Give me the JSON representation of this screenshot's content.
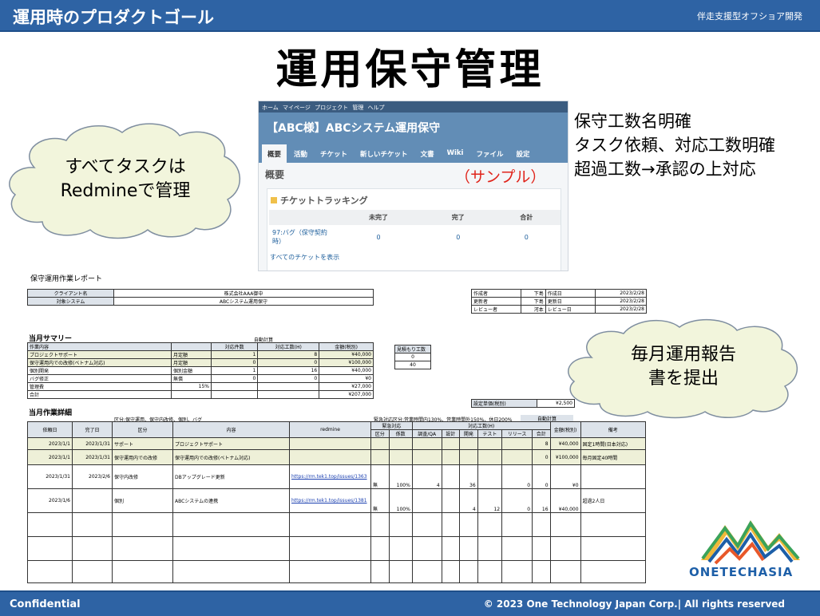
{
  "header": {
    "title": "運用時のプロダクトゴール",
    "tag": "伴走支援型オフショア開発"
  },
  "main_title": "運用保守管理",
  "cloud_left": {
    "line1": "すべてタスクは",
    "line2": "Redmineで管理"
  },
  "cloud_right": {
    "line1": "毎月運用報告",
    "line2": "書を提出"
  },
  "redmine": {
    "topnav": "ホーム マイページ プロジェクト 管理 ヘルプ",
    "project": "【ABC様】ABCシステム運用保守",
    "tabs": [
      "概要",
      "活動",
      "チケット",
      "新しいチケット",
      "文書",
      "Wiki",
      "ファイル",
      "設定"
    ],
    "overview": "概要",
    "sample": "（サンプル）",
    "tracking_title": "チケットトラッキング",
    "cols": [
      "未完了",
      "完了",
      "合計"
    ],
    "row_name": "97:バグ（保守契約時）",
    "row_values": [
      "0",
      "0",
      "0"
    ],
    "all_link": "すべてのチケットを表示"
  },
  "bullets": [
    "保守工数名明確",
    "タスク依頼、対応工数明確",
    "超過工数→承認の上対応"
  ],
  "report": {
    "title": "保守運用作業レポート",
    "client_label": "クライアント名",
    "client_value": "株式会社AAA御中",
    "system_label": "対象システム",
    "system_value": "ABCシステム運用保守",
    "meta": [
      [
        "作成者",
        "下島",
        "作成日",
        "2023/2/28"
      ],
      [
        "更新者",
        "下島",
        "更新日",
        "2023/2/28"
      ],
      [
        "レビュー者",
        "河本",
        "レビュー日",
        "2023/2/28"
      ]
    ],
    "summary_title": "当月サマリー",
    "auto_calc": "自動計算",
    "summary_header": [
      "作業内容",
      "",
      "対応件数",
      "対応工数(H)",
      "金額(税別)"
    ],
    "summary_rows": [
      [
        "プロジェクトサポート",
        "月定額",
        "1",
        "8",
        "¥40,000"
      ],
      [
        "保守運用内での改修(ベトナム対応)",
        "月定額",
        "0",
        "0",
        "¥100,000"
      ],
      [
        "個別開発",
        "個別金額",
        "1",
        "16",
        "¥40,000"
      ],
      [
        "バグ修正",
        "無償",
        "0",
        "0",
        "¥0"
      ],
      [
        "管理費",
        "15%",
        "",
        "",
        "¥27,000"
      ],
      [
        "合計",
        "",
        "",
        "",
        "¥207,000"
      ]
    ],
    "estimate_label": "見積もり工数",
    "estimate_values": [
      "0",
      "40"
    ],
    "rate_label": "設定単価(税別)",
    "rate_value": "¥2,500",
    "detail_title": "当月作業詳細",
    "detail_note1": "区分:保守運用、保守内改修、個別、バグ",
    "detail_note2": "緊急対応区分:営業時間内130%、営業時間外150%、休日200%",
    "detail_auto": "自動計算",
    "detail_header": [
      "依頼日",
      "完了日",
      "区分",
      "内容",
      "redmine",
      "緊急対応",
      "対応工数(H)",
      "金額(税別)",
      "備考"
    ],
    "detail_sub": [
      "区分",
      "係数",
      "調査/QA",
      "設計",
      "開発",
      "テスト",
      "リリース",
      "合計"
    ],
    "detail_rows": [
      [
        "2023/1/1",
        "2023/1/31",
        "サポート",
        "プロジェクトサポート",
        "",
        "",
        "",
        "",
        "",
        "",
        "",
        "",
        "8",
        "¥40,000",
        "固定1時間(日本対応)"
      ],
      [
        "2023/1/1",
        "2023/1/31",
        "保守運用内での改修",
        "保守運用内での改修(ベトナム対応)",
        "",
        "",
        "",
        "",
        "",
        "",
        "",
        "",
        "0",
        "¥100,000",
        "毎月固定40時間"
      ],
      [
        "2023/1/31",
        "2023/2/6",
        "保守内改修",
        "DBアップグレード更新",
        "https://rm.tek1.top/issues/1363",
        "無",
        "100%",
        "4",
        "",
        "36",
        "",
        "0",
        "0",
        "¥0",
        ""
      ],
      [
        "2023/1/6",
        "",
        "個別",
        "ABCシステムの連携",
        "https://rm.tek1.top/issues/1381",
        "無",
        "100%",
        "",
        "",
        "4",
        "12",
        "0",
        "16",
        "¥40,000",
        "超過2人日"
      ]
    ]
  },
  "footer": {
    "confidential": "Confidential",
    "copyright": "©  2023 One Technology Japan Corp.| All rights reserved"
  },
  "logo": {
    "text": "ONETECHASIA"
  },
  "colors": {
    "bar": "#2e63a4",
    "cloud": "#f2f5dc",
    "sample": "#e0241b"
  }
}
